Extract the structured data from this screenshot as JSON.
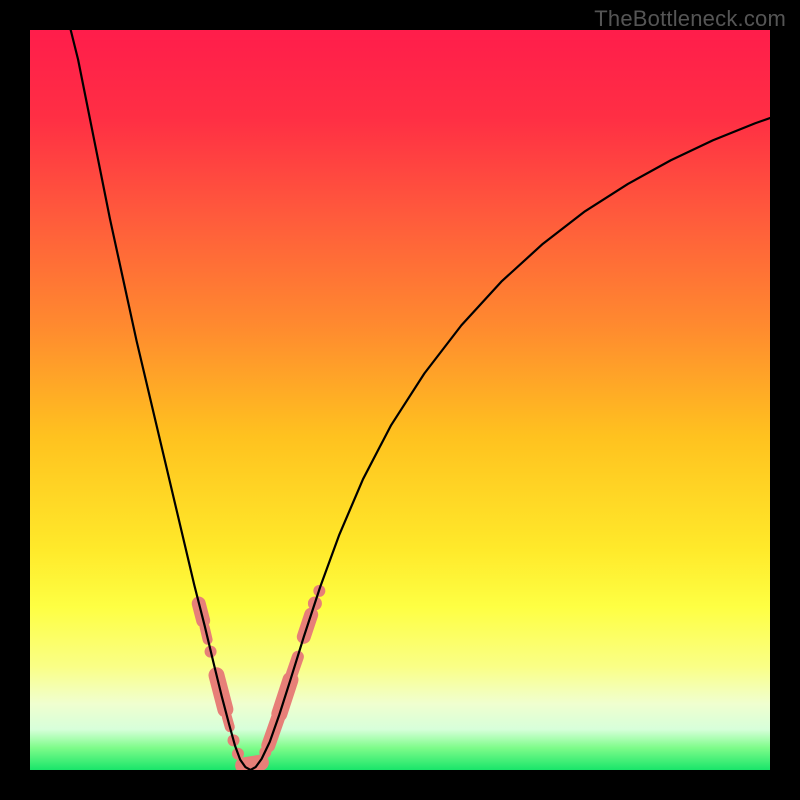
{
  "watermark": "TheBottleneck.com",
  "chart_data": {
    "type": "line",
    "title": "",
    "xlabel": "",
    "ylabel": "",
    "xlim": [
      0,
      1
    ],
    "ylim": [
      0,
      1
    ],
    "gradient_stops": [
      {
        "offset": 0.0,
        "color": "#ff1d4b"
      },
      {
        "offset": 0.12,
        "color": "#ff2f44"
      },
      {
        "offset": 0.25,
        "color": "#ff5a3c"
      },
      {
        "offset": 0.4,
        "color": "#ff8a2f"
      },
      {
        "offset": 0.55,
        "color": "#ffc21f"
      },
      {
        "offset": 0.7,
        "color": "#ffe92a"
      },
      {
        "offset": 0.78,
        "color": "#feff43"
      },
      {
        "offset": 0.86,
        "color": "#faff86"
      },
      {
        "offset": 0.91,
        "color": "#f0ffcf"
      },
      {
        "offset": 0.945,
        "color": "#d7ffda"
      },
      {
        "offset": 0.97,
        "color": "#7efc8a"
      },
      {
        "offset": 1.0,
        "color": "#19e56a"
      }
    ],
    "series": [
      {
        "name": "left-branch",
        "color": "#000000",
        "width": 2.2,
        "points": [
          [
            0.055,
            1.0
          ],
          [
            0.065,
            0.96
          ],
          [
            0.075,
            0.91
          ],
          [
            0.086,
            0.855
          ],
          [
            0.097,
            0.8
          ],
          [
            0.108,
            0.745
          ],
          [
            0.12,
            0.69
          ],
          [
            0.132,
            0.635
          ],
          [
            0.144,
            0.58
          ],
          [
            0.157,
            0.525
          ],
          [
            0.17,
            0.47
          ],
          [
            0.183,
            0.415
          ],
          [
            0.196,
            0.36
          ],
          [
            0.209,
            0.305
          ],
          [
            0.222,
            0.25
          ],
          [
            0.236,
            0.195
          ],
          [
            0.248,
            0.145
          ],
          [
            0.259,
            0.1
          ],
          [
            0.269,
            0.062
          ],
          [
            0.277,
            0.033
          ],
          [
            0.284,
            0.014
          ],
          [
            0.291,
            0.004
          ],
          [
            0.298,
            0.0
          ]
        ]
      },
      {
        "name": "right-branch",
        "color": "#000000",
        "width": 2.2,
        "points": [
          [
            0.298,
            0.0
          ],
          [
            0.305,
            0.004
          ],
          [
            0.313,
            0.015
          ],
          [
            0.324,
            0.038
          ],
          [
            0.337,
            0.075
          ],
          [
            0.352,
            0.122
          ],
          [
            0.37,
            0.18
          ],
          [
            0.392,
            0.247
          ],
          [
            0.418,
            0.318
          ],
          [
            0.45,
            0.393
          ],
          [
            0.488,
            0.466
          ],
          [
            0.533,
            0.536
          ],
          [
            0.583,
            0.601
          ],
          [
            0.637,
            0.66
          ],
          [
            0.693,
            0.711
          ],
          [
            0.75,
            0.755
          ],
          [
            0.808,
            0.792
          ],
          [
            0.866,
            0.824
          ],
          [
            0.923,
            0.851
          ],
          [
            0.98,
            0.874
          ],
          [
            1.0,
            0.881
          ]
        ]
      }
    ],
    "marker_clusters": [
      {
        "name": "left-cluster-upper",
        "color": "#e77f78",
        "segments": [
          {
            "p0": [
              0.228,
              0.225
            ],
            "p1": [
              0.234,
              0.202
            ],
            "w": 14
          },
          {
            "p0": [
              0.236,
              0.193
            ],
            "p1": [
              0.24,
              0.176
            ],
            "w": 10
          }
        ],
        "dots": [
          {
            "p": [
              0.244,
              0.16
            ],
            "r": 6
          }
        ]
      },
      {
        "name": "left-cluster-lower",
        "color": "#e77f78",
        "segments": [
          {
            "p0": [
              0.252,
              0.128
            ],
            "p1": [
              0.264,
              0.082
            ],
            "w": 16
          },
          {
            "p0": [
              0.266,
              0.072
            ],
            "p1": [
              0.27,
              0.058
            ],
            "w": 10
          }
        ],
        "dots": [
          {
            "p": [
              0.275,
              0.04
            ],
            "r": 6
          },
          {
            "p": [
              0.281,
              0.022
            ],
            "r": 6
          }
        ]
      },
      {
        "name": "valley-flat",
        "color": "#e77f78",
        "segments": [
          {
            "p0": [
              0.288,
              0.006
            ],
            "p1": [
              0.312,
              0.01
            ],
            "w": 16
          }
        ],
        "dots": []
      },
      {
        "name": "right-cluster-lower",
        "color": "#e77f78",
        "segments": [
          {
            "p0": [
              0.322,
              0.033
            ],
            "p1": [
              0.335,
              0.07
            ],
            "w": 14
          },
          {
            "p0": [
              0.337,
              0.076
            ],
            "p1": [
              0.352,
              0.122
            ],
            "w": 16
          },
          {
            "p0": [
              0.354,
              0.13
            ],
            "p1": [
              0.362,
              0.153
            ],
            "w": 12
          }
        ],
        "dots": [
          {
            "p": [
              0.318,
              0.024
            ],
            "r": 6
          }
        ]
      },
      {
        "name": "right-cluster-upper",
        "color": "#e77f78",
        "segments": [
          {
            "p0": [
              0.37,
              0.18
            ],
            "p1": [
              0.38,
              0.21
            ],
            "w": 14
          }
        ],
        "dots": [
          {
            "p": [
              0.385,
              0.225
            ],
            "r": 7
          },
          {
            "p": [
              0.391,
              0.242
            ],
            "r": 6
          }
        ]
      }
    ]
  }
}
